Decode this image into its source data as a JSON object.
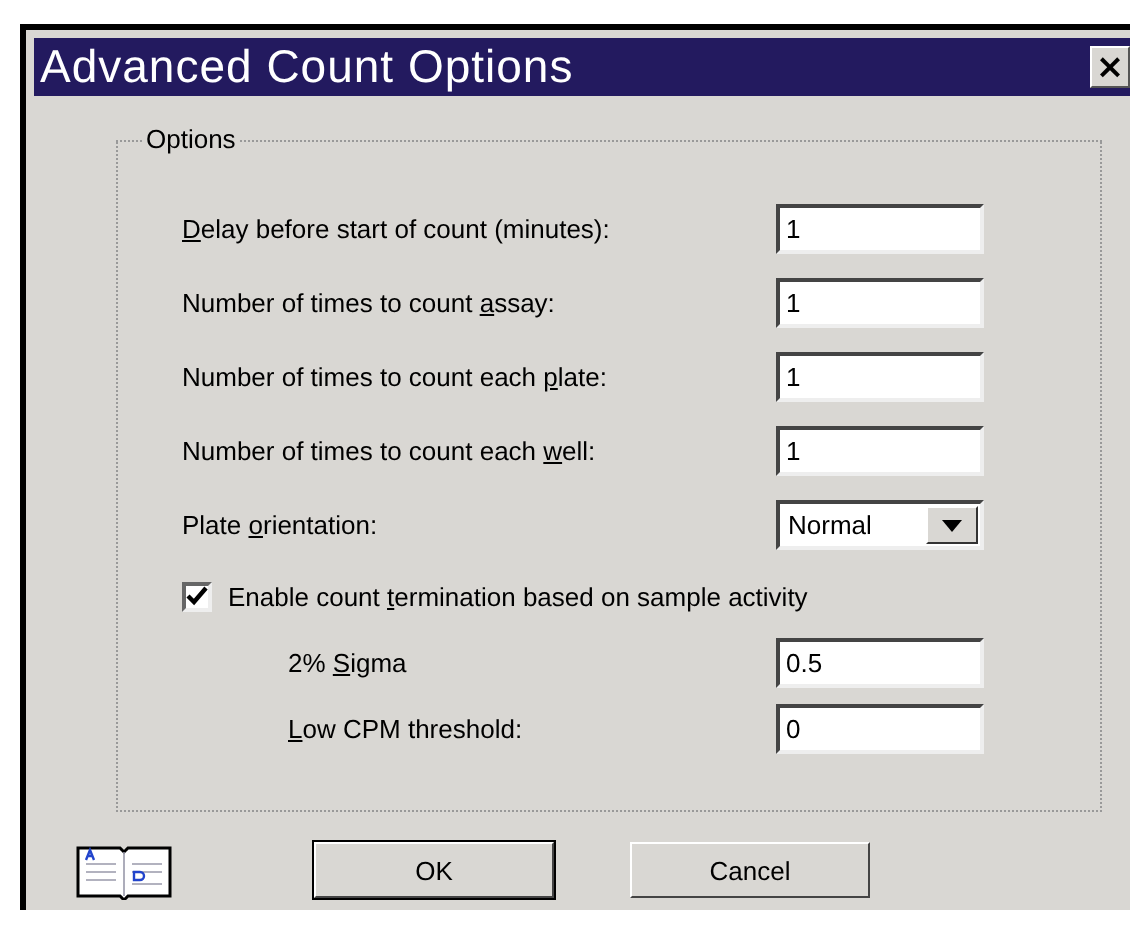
{
  "window": {
    "title": "Advanced Count Options",
    "close": "×"
  },
  "group": {
    "title": "Options",
    "fields": [
      {
        "label": {
          "key": "D",
          "post": "elay before start of count (minutes):"
        },
        "value": "1"
      },
      {
        "label": {
          "pre": "Number of times to count ",
          "key": "a",
          "post": "ssay:"
        },
        "value": "1"
      },
      {
        "label": {
          "pre": "Number of times to count each ",
          "key": "p",
          "post": "late:"
        },
        "value": "1"
      },
      {
        "label": {
          "pre": "Number of times to count each ",
          "key": "w",
          "post": "ell:"
        },
        "value": "1"
      }
    ],
    "dropdown": {
      "label": {
        "pre": "Plate ",
        "key": "o",
        "post": "rientation:"
      },
      "value": "Normal"
    },
    "checkbox": {
      "label": {
        "pre": "Enable count ",
        "key": "t",
        "post": "ermination based on sample activity"
      },
      "checked": true
    },
    "sub_fields": [
      {
        "label": {
          "pre": "2% ",
          "key": "S",
          "post": "igma"
        },
        "value": "0.5"
      },
      {
        "label": {
          "key": "L",
          "post": "ow CPM threshold:"
        },
        "value": "0"
      }
    ]
  },
  "buttons": [
    {
      "label": "OK",
      "default": true
    },
    {
      "label": "Cancel",
      "default": false
    }
  ]
}
